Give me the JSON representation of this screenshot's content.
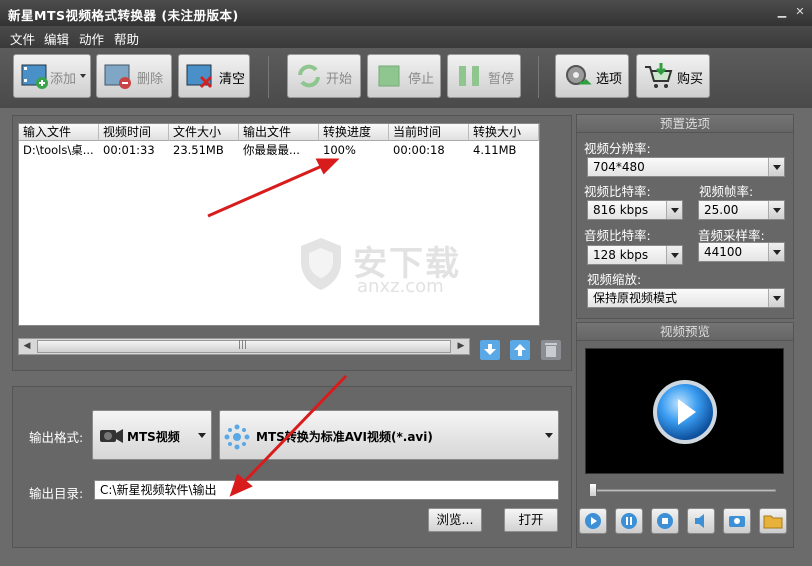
{
  "window": {
    "title": "新星MTS视频格式转换器 (未注册版本)"
  },
  "menu": [
    "文件",
    "编辑",
    "动作",
    "帮助"
  ],
  "toolbar": {
    "add": "添加",
    "delete": "删除",
    "clear": "清空",
    "start": "开始",
    "stop": "停止",
    "pause": "暂停",
    "options": "选项",
    "buy": "购买"
  },
  "file_list": {
    "columns": [
      "输入文件",
      "视频时间",
      "文件大小",
      "输出文件",
      "转换进度",
      "当前时间",
      "转换大小"
    ],
    "rows": [
      [
        "D:\\tools\\桌...",
        "00:01:33",
        "23.51MB",
        "你最最最...",
        "100%",
        "00:00:18",
        "4.11MB"
      ]
    ]
  },
  "output": {
    "format_label": "输出格式:",
    "format_category": "MTS视频",
    "format_value": "MTS转换为标准AVI视频(*.avi)",
    "dir_label": "输出目录:",
    "dir_value": "C:\\新星视频软件\\输出",
    "browse": "浏览...",
    "open": "打开"
  },
  "presets": {
    "title": "预置选项",
    "resolution_label": "视频分辨率:",
    "resolution_value": "704*480",
    "video_bitrate_label": "视频比特率:",
    "video_bitrate_value": "816 kbps",
    "framerate_label": "视频帧率:",
    "framerate_value": "25.00",
    "audio_bitrate_label": "音频比特率:",
    "audio_bitrate_value": "128 kbps",
    "samplerate_label": "音频采样率:",
    "samplerate_value": "44100",
    "scale_label": "视频缩放:",
    "scale_value": "保持原视频模式"
  },
  "preview": {
    "title": "视频预览"
  },
  "watermark": {
    "text_cn": "安下载",
    "text_en": "anxz.com"
  },
  "colors": {
    "annotation_arrow": "#d81c1c",
    "play_blue": "#2f8fe8"
  }
}
